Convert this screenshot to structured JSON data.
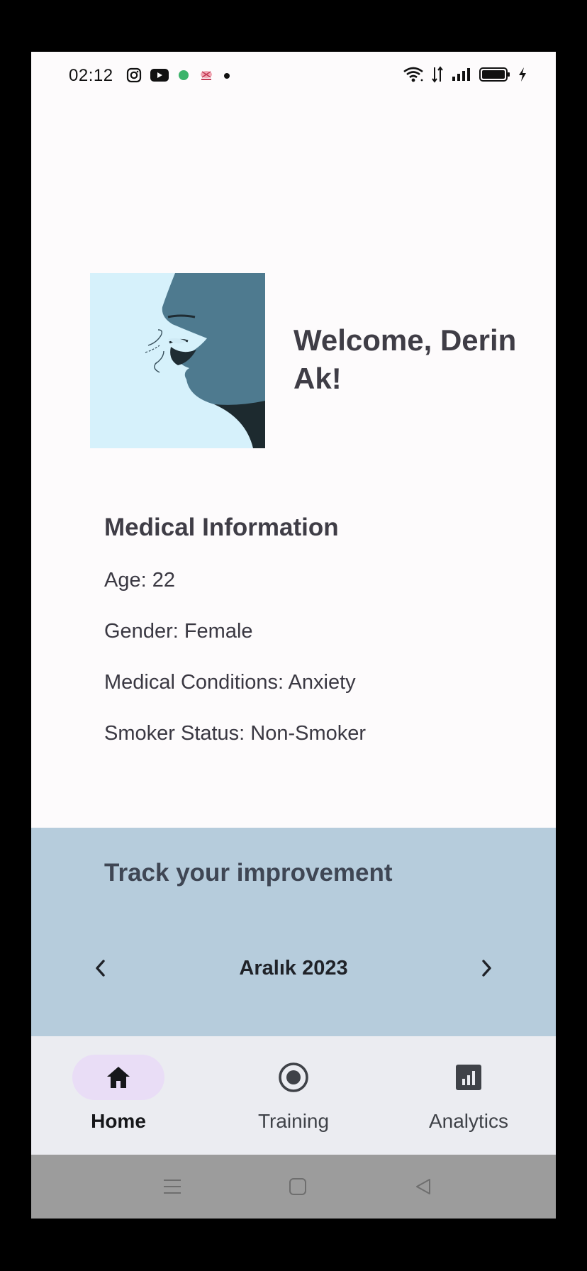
{
  "status_bar": {
    "time": "02:12",
    "left_icons": [
      "instagram-icon",
      "youtube-icon",
      "green-dot-icon",
      "app-notification-icon",
      "dot-icon"
    ],
    "right_icons": [
      "wifi-icon",
      "data-icon",
      "signal-icon",
      "battery-icon",
      "charging-icon"
    ]
  },
  "welcome": {
    "title": "Welcome, Derin Ak!",
    "image_icon": "breathing-face-illustration"
  },
  "medical": {
    "heading": "Medical Information",
    "age": "Age: 22",
    "gender": "Gender: Female",
    "conditions": "Medical Conditions: Anxiety",
    "smoker": "Smoker Status: Non-Smoker"
  },
  "tracker": {
    "title": "Track your improvement",
    "month": "Aralık 2023",
    "prev_icon": "chevron-left-icon",
    "next_icon": "chevron-right-icon"
  },
  "bottom_nav": {
    "items": [
      {
        "label": "Home",
        "icon": "home-icon",
        "active": true
      },
      {
        "label": "Training",
        "icon": "record-icon",
        "active": false
      },
      {
        "label": "Analytics",
        "icon": "analytics-icon",
        "active": false
      }
    ]
  },
  "system_nav": {
    "buttons": [
      "menu-icon",
      "home-square-icon",
      "back-icon"
    ]
  },
  "colors": {
    "background": "#fdfbfc",
    "tracker_bg": "#b6ccdc",
    "nav_bg": "#ebecf1",
    "active_pill": "#e9ddf6",
    "heading_text": "#3f3d46",
    "illustration_sky": "#d6f1fb",
    "illustration_face": "#4e7a8f"
  }
}
